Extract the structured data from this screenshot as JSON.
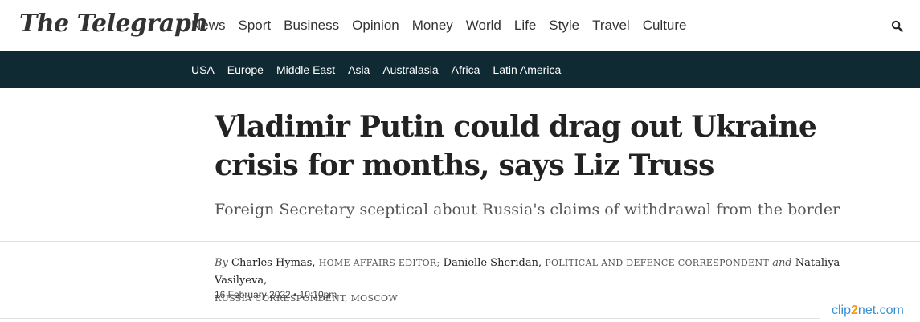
{
  "header": {
    "logo": "The Telegraph",
    "nav": [
      "News",
      "Sport",
      "Business",
      "Opinion",
      "Money",
      "World",
      "Life",
      "Style",
      "Travel",
      "Culture"
    ],
    "search_icon": "search-icon"
  },
  "section_nav": {
    "items": [
      "USA",
      "Europe",
      "Middle East",
      "Asia",
      "Australasia",
      "Africa",
      "Latin America"
    ]
  },
  "article": {
    "headline": "Vladimir Putin could drag out Ukraine crisis for months, says Liz Truss",
    "standfirst": "Foreign Secretary sceptical about Russia's claims of withdrawal from the border",
    "byline": {
      "by": "By",
      "author1": "Charles Hymas,",
      "role1": "Home Affairs Editor;",
      "author2": "Danielle Sheridan,",
      "role2": "Political and Defence Correspondent",
      "and": "and",
      "author3": "Nataliya Vasilyeva,",
      "role3": "Russia Correspondent, Moscow"
    },
    "date": "16 February 2022 • 10:10pm"
  },
  "watermark": {
    "pre": "clip",
    "mid": "2",
    "post": "net.com"
  }
}
